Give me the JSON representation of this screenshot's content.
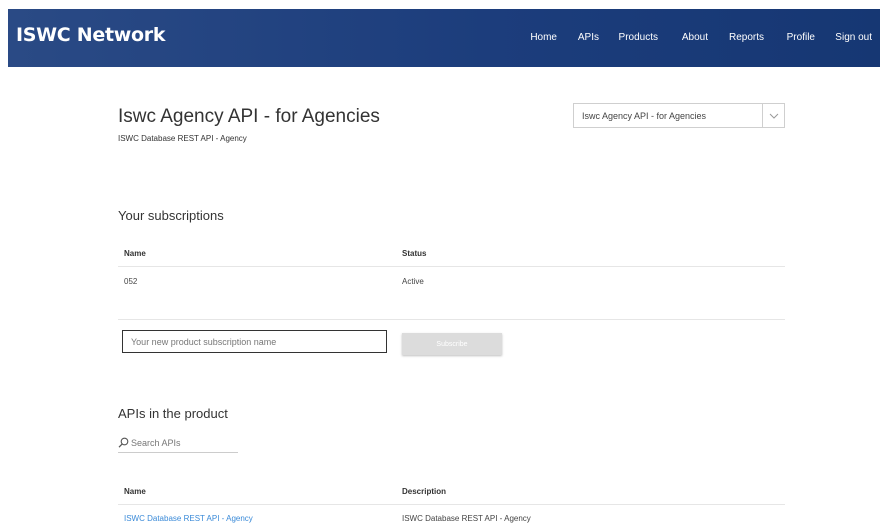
{
  "header": {
    "logo": "ISWC Network",
    "nav": [
      {
        "label": "Home"
      },
      {
        "label": "APIs"
      },
      {
        "label": "Products"
      },
      {
        "label": "About"
      },
      {
        "label": "Reports"
      },
      {
        "label": "Profile"
      },
      {
        "label": "Sign out"
      }
    ]
  },
  "product": {
    "title": "Iswc Agency API - for Agencies",
    "subtitle": "ISWC Database REST API - Agency",
    "selector_value": "Iswc Agency API - for Agencies"
  },
  "subscriptions": {
    "heading": "Your subscriptions",
    "columns": [
      "Name",
      "Status"
    ],
    "rows": [
      {
        "name": "052",
        "status": "Active"
      }
    ],
    "input_placeholder": "Your new product subscription name",
    "subscribe_label": "Subscribe"
  },
  "apis": {
    "heading": "APIs in the product",
    "search_placeholder": "Search APIs",
    "columns": [
      "Name",
      "Description"
    ],
    "rows": [
      {
        "name": "ISWC Database REST API - Agency",
        "description": "ISWC Database REST API - Agency"
      }
    ]
  },
  "colors": {
    "header_bg": "#1c3d7c",
    "link": "#3a8ad8",
    "button_disabled": "#dcdcdc"
  }
}
